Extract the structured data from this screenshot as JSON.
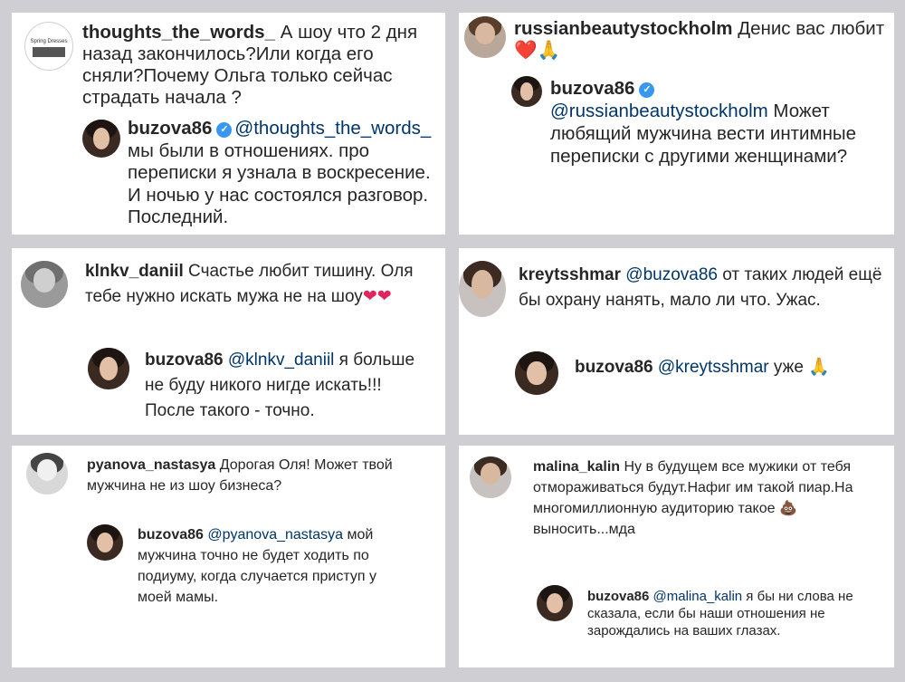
{
  "panels": [
    {
      "comment": {
        "user": "thoughts_the_words_",
        "text": " А шоу что 2 дня назад закончилось?Или когда его сняли?Почему Ольга только сейчас страдать начала ?"
      },
      "avatar_text": "Spring Dresses",
      "reply": {
        "user": "buzova86",
        "mention": "@thoughts_the_words_",
        "text": " мы были в отношениях. про переписки я узнала в воскресение. И ночью у нас состоялся разговор. Последний."
      }
    },
    {
      "comment": {
        "user": "russianbeautystockholm",
        "text": " Денис вас любит "
      },
      "comment_emoji": [
        "❤️",
        "🙏"
      ],
      "reply": {
        "user": "buzova86",
        "mention": "@russianbeautystockholm",
        "text": " Может любящий мужчина вести интимные переписки с другими женщинами?"
      }
    },
    {
      "comment": {
        "user": "klnkv_daniil",
        "text": " Счастье любит тишину. Оля тебе нужно искать мужа не на шоу"
      },
      "comment_emoji": [
        "❤",
        "❤"
      ],
      "reply": {
        "user": "buzova86",
        "mention": "@klnkv_daniil",
        "text": " я больше не буду никого нигде искать!!! После такого - точно."
      }
    },
    {
      "comment": {
        "user": "kreytsshmar",
        "mention": " @buzova86",
        "text": " от таких людей ещё бы охрану нанять, мало ли что. Ужас."
      },
      "reply": {
        "user": "buzova86",
        "mention": " @kreytsshmar",
        "text": " уже "
      },
      "reply_emoji": [
        "🙏"
      ]
    },
    {
      "comment": {
        "user": "pyanova_nastasya",
        "text": " Дорогая Оля! Может твой мужчина не из шоу бизнеса?"
      },
      "reply": {
        "user": "buzova86",
        "mention": " @pyanova_nastasya",
        "text": " мой мужчина точно не будет ходить по подиуму, когда случается приступ у моей мамы."
      }
    },
    {
      "comment": {
        "user": "malina_kalin",
        "text": " Ну в будущем все мужики от тебя отмораживаться будут.Нафиг им такой пиар.На многомиллионную аудиторию такое ",
        "text_after": " выносить...мда"
      },
      "comment_emoji": [
        "💩"
      ],
      "reply": {
        "user": "buzova86",
        "mention": " @malina_kalin",
        "text": " я бы ни слова не сказала, если бы наши отношения не зарождались на ваших глазах."
      }
    }
  ],
  "colors": {
    "background": "#cfcfd3",
    "panel": "#ffffff",
    "text": "#262626",
    "mention": "#003569",
    "verified": "#3897f0"
  },
  "icons": {
    "verified": "verified-badge-icon",
    "heart": "red-heart-emoji",
    "hands": "folded-hands-emoji",
    "poop": "pile-of-poo-emoji"
  }
}
